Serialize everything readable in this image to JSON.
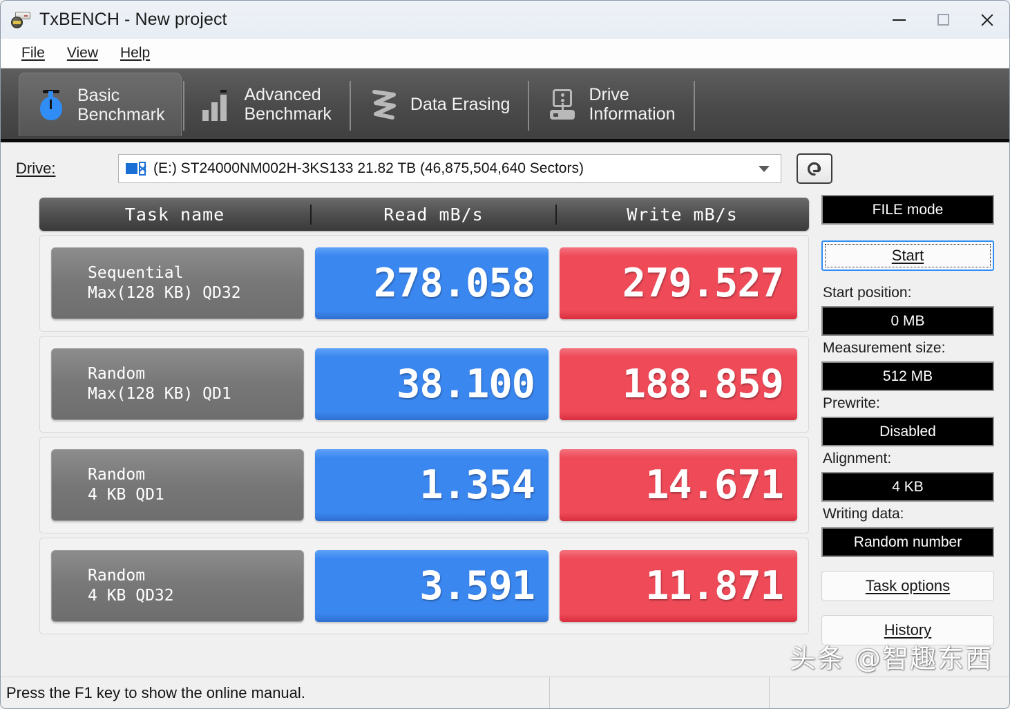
{
  "window": {
    "title": "TxBENCH - New project",
    "app_icon": "drive-stopwatch-icon",
    "controls": {
      "minimize": "minimize-icon",
      "maximize": "maximize-icon",
      "close": "close-icon"
    }
  },
  "menu": {
    "items": [
      "File",
      "View",
      "Help"
    ]
  },
  "tabs": [
    {
      "label": "Basic\nBenchmark",
      "icon": "stopwatch-icon",
      "active": true
    },
    {
      "label": "Advanced\nBenchmark",
      "icon": "bar-chart-icon",
      "active": false
    },
    {
      "label": "Data Erasing",
      "icon": "zigzag-erase-icon",
      "active": false
    },
    {
      "label": "Drive\nInformation",
      "icon": "drive-info-icon",
      "active": false
    }
  ],
  "drive": {
    "label": "Drive:",
    "selected": "(E:) ST24000NM002H-3KS133  21.82 TB (46,875,504,640 Sectors)",
    "icon": "network-drive-icon",
    "refresh_icon": "refresh-icon"
  },
  "mode_badge": "FILE mode",
  "table": {
    "headers": [
      "Task name",
      "Read mB/s",
      "Write mB/s"
    ],
    "rows": [
      {
        "name_line1": "Sequential",
        "name_line2": "Max(128 KB) QD32",
        "read": "278.058",
        "write": "279.527"
      },
      {
        "name_line1": "Random",
        "name_line2": "Max(128 KB) QD1",
        "read": "38.100",
        "write": "188.859"
      },
      {
        "name_line1": "Random",
        "name_line2": "4 KB QD1",
        "read": "1.354",
        "write": "14.671"
      },
      {
        "name_line1": "Random",
        "name_line2": "4 KB QD32",
        "read": "3.591",
        "write": "11.871"
      }
    ]
  },
  "sidebar": {
    "start_button": "Start",
    "fields": [
      {
        "label": "Start position:",
        "value": "0 MB"
      },
      {
        "label": "Measurement size:",
        "value": "512 MB"
      },
      {
        "label": "Prewrite:",
        "value": "Disabled"
      },
      {
        "label": "Alignment:",
        "value": "4 KB"
      },
      {
        "label": "Writing data:",
        "value": "Random number"
      }
    ],
    "task_options_button": "Task options",
    "history_button": "History"
  },
  "statusbar": {
    "message": "Press the F1 key to show the online manual."
  },
  "watermark": "头条 @智趣东西",
  "colors": {
    "read_cell": "#3b87f0",
    "write_cell": "#ef4a58",
    "task_cell": "#777777",
    "tabstrip": "#4a4a4a",
    "accent_focus": "#2f8df5"
  }
}
